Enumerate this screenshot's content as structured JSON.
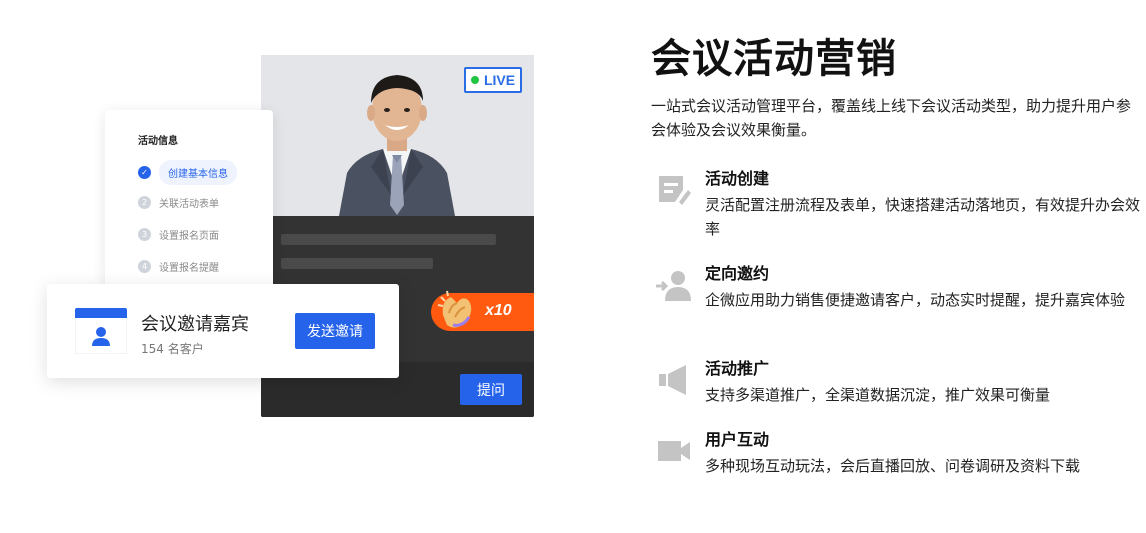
{
  "illustration": {
    "live_label": "LIVE",
    "steps_title": "活动信息",
    "steps": [
      {
        "num": "",
        "label": "创建基本信息",
        "active": true
      },
      {
        "num": "2",
        "label": "关联活动表单",
        "active": false
      },
      {
        "num": "3",
        "label": "设置报名页面",
        "active": false
      },
      {
        "num": "4",
        "label": "设置报名提醒",
        "active": false
      }
    ],
    "invite_title": "会议邀请嘉宾",
    "invite_sub": "154 名客户",
    "send_button": "发送邀请",
    "clap_count": "x10",
    "ask_button": "提问",
    "colors": {
      "accent": "#2563eb",
      "live_green": "#1fc640",
      "clap_orange": "#ff5a10"
    }
  },
  "content": {
    "title": "会议活动营销",
    "description": "一站式会议活动管理平台，覆盖线上线下会议活动类型，助力提升用户参会体验及会议效果衡量。",
    "features": [
      {
        "icon": "edit-form-icon",
        "title": "活动创建",
        "desc": "灵活配置注册流程及表单，快速搭建活动落地页，有效提升办会效率"
      },
      {
        "icon": "add-user-icon",
        "title": "定向邀约",
        "desc": "企微应用助力销售便捷邀请客户，动态实时提醒，提升嘉宾体验"
      },
      {
        "icon": "megaphone-icon",
        "title": "活动推广",
        "desc": "支持多渠道推广，全渠道数据沉淀，推广效果可衡量"
      },
      {
        "icon": "video-camera-icon",
        "title": "用户互动",
        "desc": "多种现场互动玩法，会后直播回放、问卷调研及资料下载"
      }
    ]
  }
}
